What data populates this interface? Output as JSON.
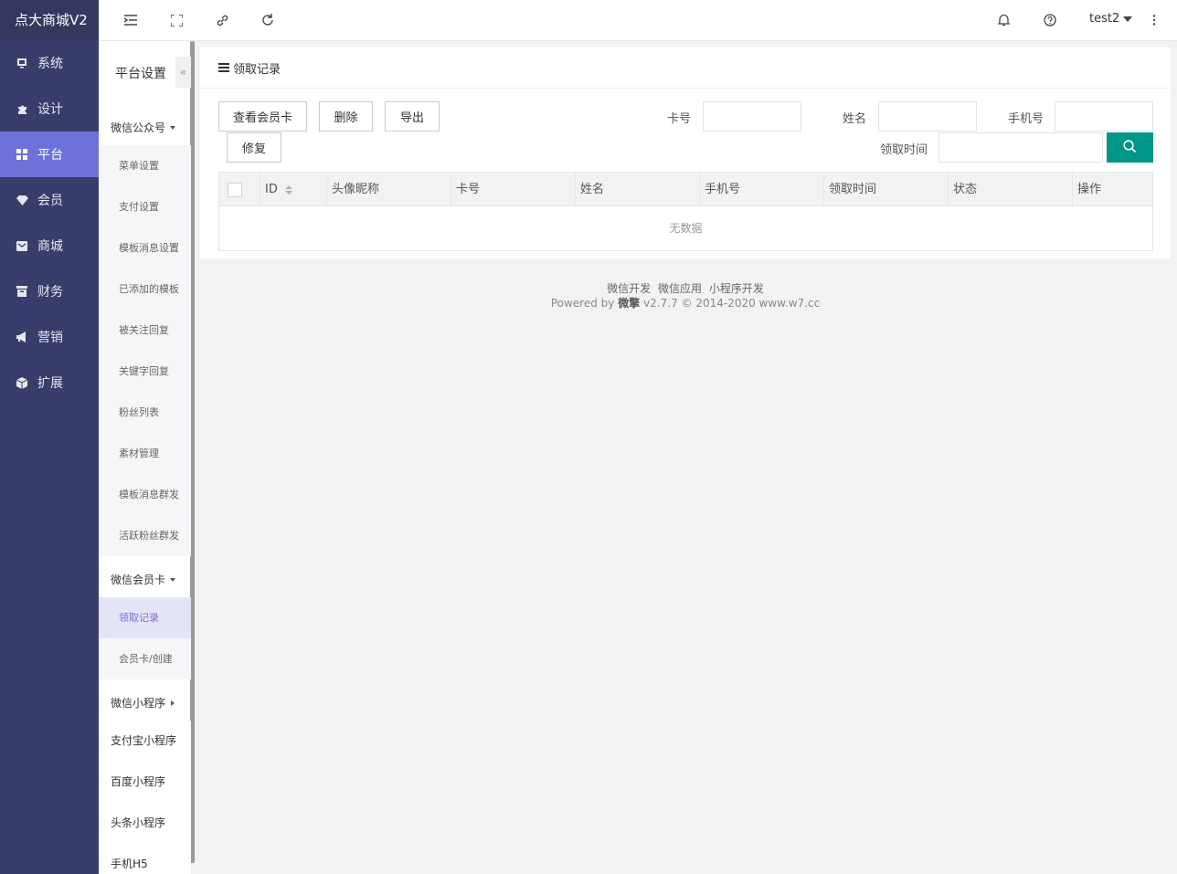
{
  "brand": "点大商城V2",
  "nav": {
    "items": [
      {
        "label": "系统",
        "icon": "monitor-icon"
      },
      {
        "label": "设计",
        "icon": "puzzle-icon"
      },
      {
        "label": "平台",
        "icon": "grid-icon",
        "active": true
      },
      {
        "label": "会员",
        "icon": "gem-icon"
      },
      {
        "label": "商城",
        "icon": "mail-icon"
      },
      {
        "label": "财务",
        "icon": "box-icon"
      },
      {
        "label": "营销",
        "icon": "megaphone-icon"
      },
      {
        "label": "扩展",
        "icon": "cube-icon"
      }
    ]
  },
  "topbar": {
    "icons": [
      "menu-fold-icon",
      "fullscreen-icon",
      "link-icon",
      "refresh-icon"
    ],
    "right_icons": [
      "bell-icon",
      "help-icon",
      "more-icon"
    ],
    "user": "test2"
  },
  "subnav": {
    "title": "平台设置",
    "collapse_label": "«",
    "group_wechat_official": "微信公众号",
    "official_items": [
      "菜单设置",
      "支付设置",
      "模板消息设置",
      "已添加的模板",
      "被关注回复",
      "关键字回复",
      "粉丝列表",
      "素材管理",
      "模板消息群发",
      "活跃粉丝群发"
    ],
    "group_member_card": "微信会员卡",
    "card_items": [
      "领取记录",
      "会员卡/创建"
    ],
    "group_wechat_mini": "微信小程序",
    "plain_items": [
      "支付宝小程序",
      "百度小程序",
      "头条小程序",
      "手机H5"
    ]
  },
  "panel": {
    "title": "领取记录",
    "buttons": {
      "view_card": "查看会员卡",
      "delete": "删除",
      "export": "导出",
      "repair": "修复"
    },
    "filters": {
      "card_no": "卡号",
      "name": "姓名",
      "phone": "手机号",
      "time": "领取时间"
    },
    "table": {
      "columns": [
        "ID",
        "头像昵称",
        "卡号",
        "姓名",
        "手机号",
        "领取时间",
        "状态",
        "操作"
      ],
      "empty": "无数据"
    }
  },
  "footer": {
    "links": [
      "微信开发",
      "微信应用",
      "小程序开发"
    ],
    "powered_prefix": "Powered by",
    "powered_brand": "微擎",
    "powered_suffix": "v2.7.7 © 2014-2020 www.w7.cc"
  },
  "colors": {
    "nav_bg": "#393d6b",
    "nav_active": "#6e71d8",
    "search_btn": "#009688"
  }
}
